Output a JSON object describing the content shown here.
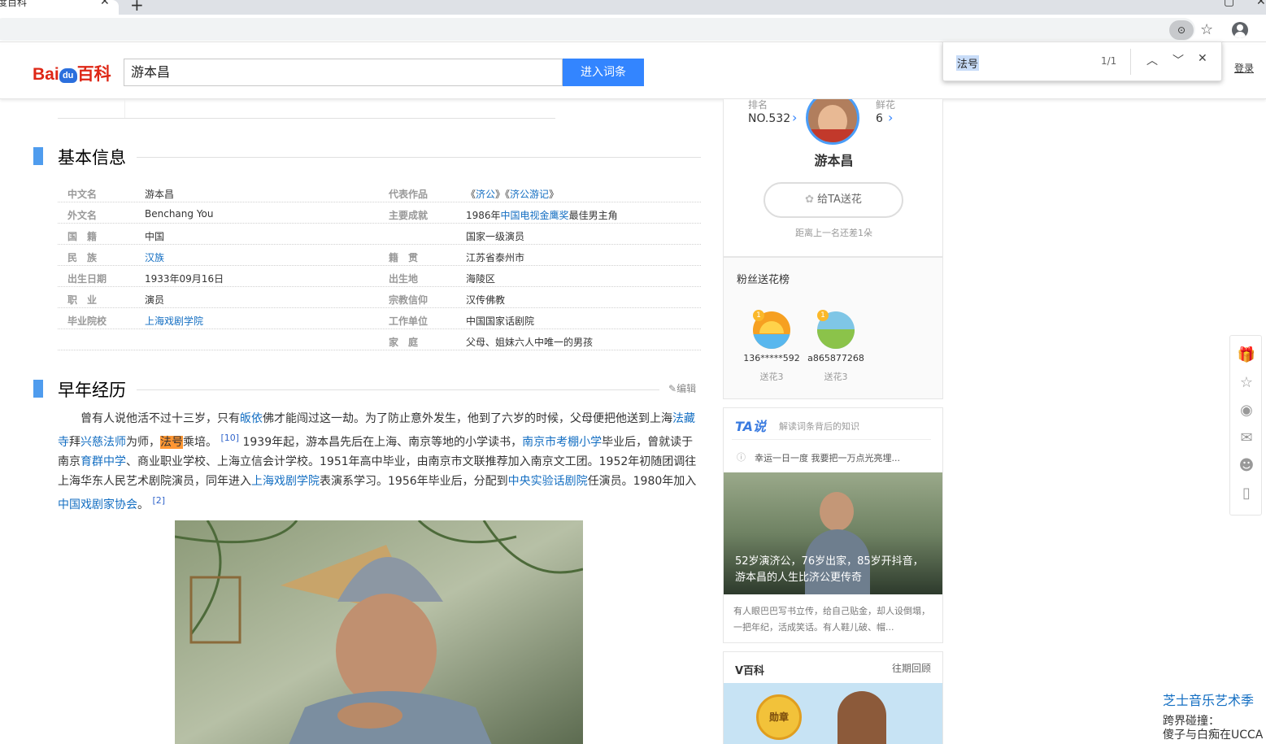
{
  "browser": {
    "tab_title": "度百科",
    "new_tab": "+",
    "find_query": "法号",
    "find_count": "1/1"
  },
  "header": {
    "logo_text_a": "Bai",
    "logo_text_b": "du",
    "logo_text_c": "百科",
    "search_value": "游本昌",
    "search_button": "进入词条",
    "login": "登录"
  },
  "basic_info": {
    "title": "基本信息",
    "rows": [
      {
        "l1": "中文名",
        "v1": "游本昌",
        "l2": "代表作品",
        "v2a": "《",
        "v2b": "济公",
        "v2c": "》《",
        "v2d": "济公游记",
        "v2e": "》"
      },
      {
        "l1": "外文名",
        "v1": "Benchang You",
        "l2": "主要成就",
        "v2a": "1986年",
        "v2b": "中国电视金鹰奖",
        "v2c": "最佳男主角",
        "v2d": "",
        "v2e": ""
      },
      {
        "l1": "国　籍",
        "v1": "中国",
        "l2": "",
        "v2a": "国家一级演员",
        "v2b": "",
        "v2c": "",
        "v2d": "",
        "v2e": ""
      },
      {
        "l1": "民　族",
        "v1": "汉族",
        "l2": "籍　贯",
        "v2a": "江苏省泰州市",
        "v2b": "",
        "v2c": "",
        "v2d": "",
        "v2e": ""
      },
      {
        "l1": "出生日期",
        "v1": "1933年09月16日",
        "l2": "出生地",
        "v2a": "海陵区",
        "v2b": "",
        "v2c": "",
        "v2d": "",
        "v2e": ""
      },
      {
        "l1": "职　业",
        "v1": "演员",
        "l2": "宗教信仰",
        "v2a": "汉传佛教",
        "v2b": "",
        "v2c": "",
        "v2d": "",
        "v2e": ""
      },
      {
        "l1": "毕业院校",
        "v1": "上海戏剧学院",
        "l2": "工作单位",
        "v2a": "中国国家话剧院",
        "v2b": "",
        "v2c": "",
        "v2d": "",
        "v2e": ""
      },
      {
        "l1": "",
        "v1": "",
        "l2": "家　庭",
        "v2a": "父母、姐妹六人中唯一的男孩",
        "v2b": "",
        "v2c": "",
        "v2d": "",
        "v2e": ""
      }
    ]
  },
  "early": {
    "title": "早年经历",
    "edit": "编辑",
    "p": [
      "曾有人说他活不过十三岁，只有",
      "皈依",
      "佛才能闯过这一劫。为了防止意外发生，他到了六岁的时候，父母便把他送到上海",
      "法藏寺",
      "拜",
      "兴慈法师",
      "为师，",
      "法号",
      "乘培。",
      "[10]",
      " 1939年起，游本昌先后在上海、南京等地的小学读书，",
      "南京市考棚小学",
      "毕业后，曾就读于南京",
      "育群中学",
      "、商业职业学校、上海立信会计学校。1951年高中毕业，由南京市文联推荐加入南京文工团。1952年初随团调往上海华东人民艺术剧院演员，同年进入",
      "上海戏剧学院",
      "表演系学习。1956年毕业后，分配到",
      "中央实验话剧院",
      "任演员。1980年加入",
      "中国戏剧家协会",
      "。",
      "[2]"
    ]
  },
  "profile": {
    "rank_label": "排名",
    "rank_value": "NO.532",
    "flower_label": "鲜花",
    "flower_value": "6",
    "name": "游本昌",
    "give_button": "给TA送花",
    "gap_text": "距离上一名还差1朵"
  },
  "fans": {
    "title": "粉丝送花榜",
    "items": [
      {
        "name": "136*****592",
        "count": "送花3"
      },
      {
        "name": "a865877268",
        "count": "送花3"
      }
    ]
  },
  "ta": {
    "logo": "TA说",
    "subtitle": "解读词条背后的知识",
    "author": "幸运一日一度  我要把一万点光亮埋...",
    "caption": "52岁演济公，76岁出家，85岁开抖音，游本昌的人生比济公更传奇",
    "desc": "有人眼巴巴写书立传，给自己贴金，却人设倒塌，一把年纪，活成笑话。有人鞋儿破、帽..."
  },
  "vbaike": {
    "title": "V百科",
    "link": "往期回顾",
    "badge": "勋章"
  },
  "ad": {
    "line1": "芝士音乐艺术季",
    "line2": "跨界碰撞：",
    "line3": "傻子与白痴在UCCA"
  }
}
